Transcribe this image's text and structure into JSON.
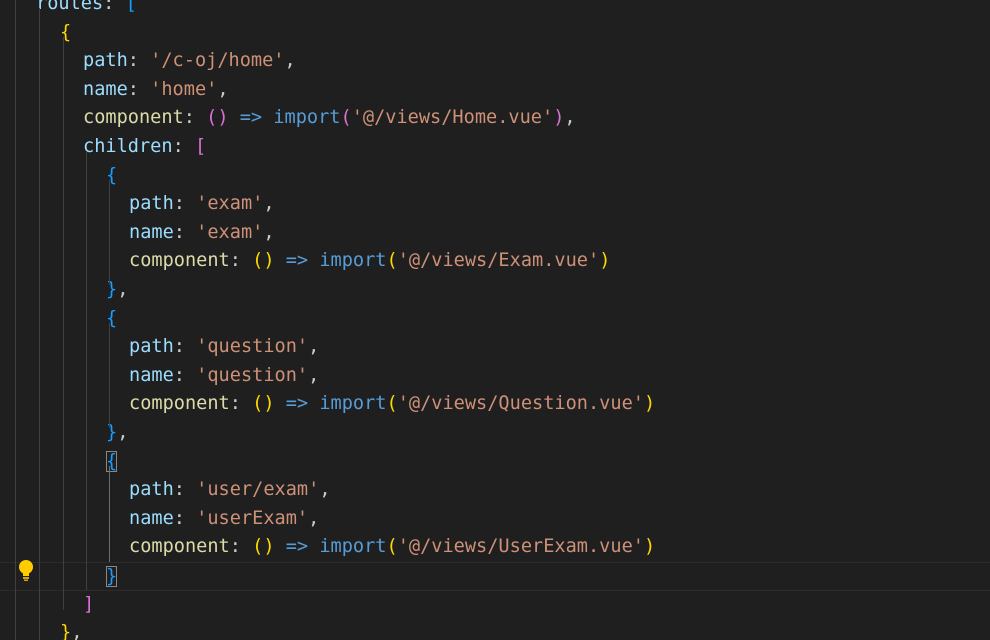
{
  "editor": {
    "lines": [
      {
        "tokens": [
          {
            "t": "routes",
            "c": "k"
          },
          {
            "t": ": ",
            "c": "p"
          },
          {
            "t": "[",
            "c": "b3"
          }
        ]
      },
      {
        "tokens": [
          {
            "t": "{",
            "c": "b1"
          }
        ]
      },
      {
        "tokens": [
          {
            "t": "path",
            "c": "k"
          },
          {
            "t": ": ",
            "c": "p"
          },
          {
            "t": "'/c-oj/home'",
            "c": "s"
          },
          {
            "t": ",",
            "c": "p"
          }
        ]
      },
      {
        "tokens": [
          {
            "t": "name",
            "c": "k"
          },
          {
            "t": ": ",
            "c": "p"
          },
          {
            "t": "'home'",
            "c": "s"
          },
          {
            "t": ",",
            "c": "p"
          }
        ]
      },
      {
        "tokens": [
          {
            "t": "component",
            "c": "f"
          },
          {
            "t": ": ",
            "c": "p"
          },
          {
            "t": "()",
            "c": "b2"
          },
          {
            "t": " => ",
            "c": "kw"
          },
          {
            "t": "import",
            "c": "kw"
          },
          {
            "t": "(",
            "c": "b2"
          },
          {
            "t": "'@/views/Home.vue'",
            "c": "s"
          },
          {
            "t": ")",
            "c": "b2"
          },
          {
            "t": ",",
            "c": "p"
          }
        ]
      },
      {
        "tokens": [
          {
            "t": "children",
            "c": "k"
          },
          {
            "t": ": ",
            "c": "p"
          },
          {
            "t": "[",
            "c": "b2"
          }
        ]
      },
      {
        "tokens": [
          {
            "t": "{",
            "c": "b3"
          }
        ]
      },
      {
        "tokens": [
          {
            "t": "path",
            "c": "k"
          },
          {
            "t": ": ",
            "c": "p"
          },
          {
            "t": "'exam'",
            "c": "s"
          },
          {
            "t": ",",
            "c": "p"
          }
        ]
      },
      {
        "tokens": [
          {
            "t": "name",
            "c": "k"
          },
          {
            "t": ": ",
            "c": "p"
          },
          {
            "t": "'exam'",
            "c": "s"
          },
          {
            "t": ",",
            "c": "p"
          }
        ]
      },
      {
        "tokens": [
          {
            "t": "component",
            "c": "f"
          },
          {
            "t": ": ",
            "c": "p"
          },
          {
            "t": "()",
            "c": "b1"
          },
          {
            "t": " => ",
            "c": "kw"
          },
          {
            "t": "import",
            "c": "kw"
          },
          {
            "t": "(",
            "c": "b1"
          },
          {
            "t": "'@/views/Exam.vue'",
            "c": "s"
          },
          {
            "t": ")",
            "c": "b1"
          }
        ]
      },
      {
        "tokens": [
          {
            "t": "}",
            "c": "b3"
          },
          {
            "t": ",",
            "c": "p"
          }
        ]
      },
      {
        "tokens": [
          {
            "t": "{",
            "c": "b3"
          }
        ]
      },
      {
        "tokens": [
          {
            "t": "path",
            "c": "k"
          },
          {
            "t": ": ",
            "c": "p"
          },
          {
            "t": "'question'",
            "c": "s"
          },
          {
            "t": ",",
            "c": "p"
          }
        ]
      },
      {
        "tokens": [
          {
            "t": "name",
            "c": "k"
          },
          {
            "t": ": ",
            "c": "p"
          },
          {
            "t": "'question'",
            "c": "s"
          },
          {
            "t": ",",
            "c": "p"
          }
        ]
      },
      {
        "tokens": [
          {
            "t": "component",
            "c": "f"
          },
          {
            "t": ": ",
            "c": "p"
          },
          {
            "t": "()",
            "c": "b1"
          },
          {
            "t": " => ",
            "c": "kw"
          },
          {
            "t": "import",
            "c": "kw"
          },
          {
            "t": "(",
            "c": "b1"
          },
          {
            "t": "'@/views/Question.vue'",
            "c": "s"
          },
          {
            "t": ")",
            "c": "b1"
          }
        ]
      },
      {
        "tokens": [
          {
            "t": "}",
            "c": "b3"
          },
          {
            "t": ",",
            "c": "p"
          }
        ]
      },
      {
        "tokens": [
          {
            "t": "{",
            "c": "b3",
            "match": true
          }
        ]
      },
      {
        "tokens": [
          {
            "t": "path",
            "c": "k"
          },
          {
            "t": ": ",
            "c": "p"
          },
          {
            "t": "'user/exam'",
            "c": "s"
          },
          {
            "t": ",",
            "c": "p"
          }
        ]
      },
      {
        "tokens": [
          {
            "t": "name",
            "c": "k"
          },
          {
            "t": ": ",
            "c": "p"
          },
          {
            "t": "'userExam'",
            "c": "s"
          },
          {
            "t": ",",
            "c": "p"
          }
        ]
      },
      {
        "tokens": [
          {
            "t": "component",
            "c": "f"
          },
          {
            "t": ": ",
            "c": "p"
          },
          {
            "t": "()",
            "c": "b1"
          },
          {
            "t": " => ",
            "c": "kw"
          },
          {
            "t": "import",
            "c": "kw"
          },
          {
            "t": "(",
            "c": "b1"
          },
          {
            "t": "'@/views/UserExam.vue'",
            "c": "s"
          },
          {
            "t": ")",
            "c": "b1"
          }
        ]
      },
      {
        "tokens": [
          {
            "t": "}",
            "c": "b3",
            "match": true
          }
        ]
      },
      {
        "tokens": [
          {
            "t": "]",
            "c": "b2"
          }
        ]
      },
      {
        "tokens": [
          {
            "t": "}",
            "c": "b1"
          },
          {
            "t": ",",
            "c": "p"
          }
        ]
      }
    ],
    "lightbulb_icon": "lightbulb-icon",
    "colors": {
      "background": "#1f1f1f",
      "property": "#9cdcfe",
      "string": "#ce9178",
      "function": "#dcdcaa",
      "keyword": "#569cd6",
      "bracket_gold": "#ffd700",
      "bracket_orchid": "#da70d6",
      "bracket_blue": "#179fff"
    }
  }
}
